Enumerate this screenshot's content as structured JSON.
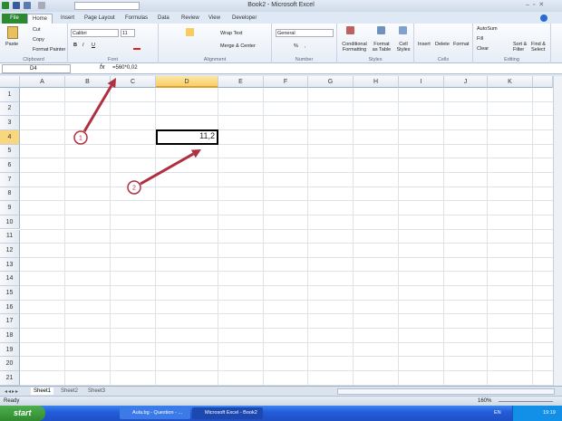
{
  "window": {
    "title": "Book2 - Microsoft Excel"
  },
  "tabs": [
    "File",
    "Home",
    "Insert",
    "Page Layout",
    "Formulas",
    "Data",
    "Review",
    "View",
    "Developer"
  ],
  "ribbon": {
    "clipboard": {
      "label": "Clipboard",
      "paste": "Paste",
      "cut": "Cut",
      "copy": "Copy",
      "format_painter": "Format Painter"
    },
    "font": {
      "label": "Font",
      "name": "Calibri",
      "size": "11",
      "bold": "B",
      "italic": "I",
      "underline": "U"
    },
    "alignment": {
      "label": "Alignment",
      "wrap": "Wrap Text",
      "merge": "Merge & Center"
    },
    "number": {
      "label": "Number",
      "format": "General",
      "percent": "%",
      "comma": ","
    },
    "styles": {
      "label": "Styles",
      "conditional": "Conditional Formatting",
      "format_table": "Format as Table",
      "cell_styles": "Cell Styles"
    },
    "cells": {
      "label": "Cells",
      "insert": "Insert",
      "delete": "Delete",
      "format": "Format"
    },
    "editing": {
      "label": "Editing",
      "autosum": "AutoSum",
      "fill": "Fill",
      "clear": "Clear",
      "sort": "Sort & Filter",
      "find": "Find & Select"
    }
  },
  "formula_bar": {
    "name_box": "D4",
    "fx": "fx",
    "formula": "=560*0,02"
  },
  "columns": [
    "A",
    "B",
    "C",
    "D",
    "E",
    "F",
    "G",
    "H",
    "I",
    "J",
    "K"
  ],
  "rows": [
    "1",
    "2",
    "3",
    "4",
    "5",
    "6",
    "7",
    "8",
    "9",
    "10",
    "11",
    "12",
    "13",
    "14",
    "15",
    "16",
    "17",
    "18",
    "19",
    "20",
    "21"
  ],
  "active_cell": {
    "ref": "D4",
    "value": "11,2"
  },
  "annotations": [
    "1",
    "2"
  ],
  "annotation_color": "#b03040",
  "sheets": [
    "Sheet1",
    "Sheet2",
    "Sheet3"
  ],
  "status": {
    "ready": "Ready",
    "zoom": "160%"
  },
  "taskbar": {
    "start": "start",
    "items": [
      "Aula.bg - Question - ...",
      "Microsoft Excel - Book2"
    ],
    "lang": "EN",
    "clock": "19:19"
  }
}
